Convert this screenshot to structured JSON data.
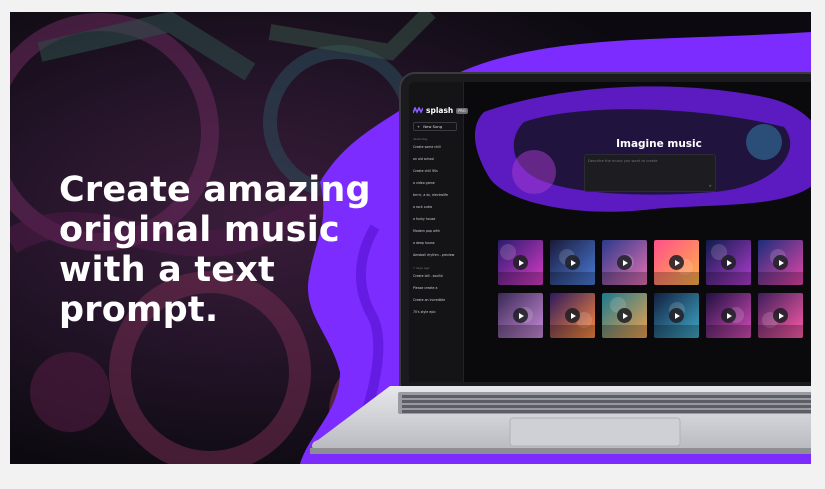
{
  "headline": {
    "line1": "Create amazing",
    "line2": "original music",
    "line3": "with a text",
    "line4": "prompt."
  },
  "app": {
    "brand": "splash",
    "badge": "PRO",
    "new_song_label": "New Song",
    "sections": {
      "recent": "Yesterday",
      "older": "7 days ago"
    },
    "history_recent": [
      "Create some chill",
      "an old school",
      "Create chill 90s",
      "a video game",
      "brrrrr, a dc, electrolife",
      "a rock outro",
      "a funky house",
      "Modern pop with",
      "a deep house",
      "Aeroball rhythm - preview"
    ],
    "history_older": [
      "Create lofi - soulful",
      "Please create a",
      "Create an incredible",
      "70's style epic"
    ],
    "main_title": "Imagine music",
    "prompt_placeholder": "Describe the music you want to create",
    "thumbnails": [
      {
        "name": "neon-arena",
        "c1": "#2a1a6e",
        "c2": "#d93cc6"
      },
      {
        "name": "speaker-vortex",
        "c1": "#1a1a3a",
        "c2": "#4a7bd9"
      },
      {
        "name": "retro-city",
        "c1": "#2b3a8a",
        "c2": "#e56fb3"
      },
      {
        "name": "guitarist-sunset",
        "c1": "#ff4f8b",
        "c2": "#ffb347"
      },
      {
        "name": "headphones-girl",
        "c1": "#0f1b4c",
        "c2": "#b03ccf"
      },
      {
        "name": "dancers-club",
        "c1": "#1b2e7a",
        "c2": "#e545a8"
      },
      {
        "name": "studio-mic",
        "c1": "#3a2a55",
        "c2": "#c98bd9"
      },
      {
        "name": "synth-road",
        "c1": "#2d1a5e",
        "c2": "#ff8a3d"
      },
      {
        "name": "crowd-sunrise",
        "c1": "#1a7a8f",
        "c2": "#f0a14f"
      },
      {
        "name": "headphone-portrait",
        "c1": "#132040",
        "c2": "#3fa8c8"
      },
      {
        "name": "cosmic-girl",
        "c1": "#201040",
        "c2": "#d44cb8"
      },
      {
        "name": "dj-booth",
        "c1": "#3c1e5a",
        "c2": "#ff5ca8"
      }
    ]
  },
  "colors": {
    "accent": "#7c2cff",
    "accent_dark": "#5a14d6",
    "background": "#0d0a12"
  }
}
